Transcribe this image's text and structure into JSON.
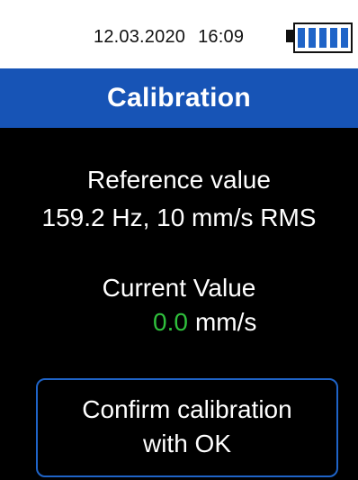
{
  "status_bar": {
    "date": "12.03.2020",
    "time": "16:09",
    "battery_icon": "battery-full-icon",
    "battery_cells": 5,
    "battery_color": "#1f64c8"
  },
  "header": {
    "title": "Calibration",
    "background": "#1754b6"
  },
  "reference": {
    "label": "Reference value",
    "value": "159.2 Hz, 10 mm/s RMS"
  },
  "current": {
    "label": "Current Value",
    "value": "0.0",
    "unit": "mm/s",
    "value_color": "#2fbf3c"
  },
  "confirm": {
    "line1": "Confirm calibration",
    "line2": "with OK",
    "border_color": "#1f64c8"
  }
}
